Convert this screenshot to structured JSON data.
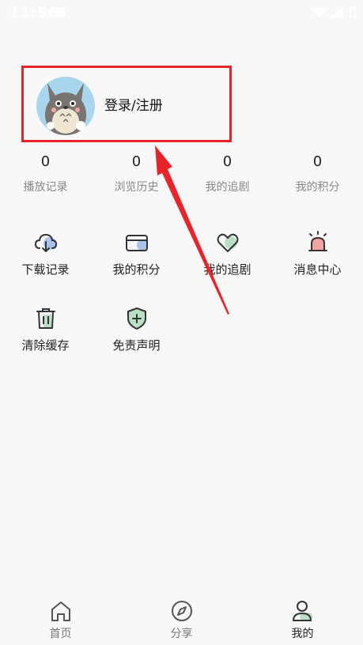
{
  "status": {
    "time": "11:56"
  },
  "profile": {
    "login_label": "登录/注册"
  },
  "stats": [
    {
      "value": "0",
      "label": "播放记录"
    },
    {
      "value": "0",
      "label": "浏览历史"
    },
    {
      "value": "0",
      "label": "我的追剧"
    },
    {
      "value": "0",
      "label": "我的积分"
    }
  ],
  "menu": [
    {
      "label": "下载记录",
      "icon": "cloud-download-icon"
    },
    {
      "label": "我的积分",
      "icon": "card-icon"
    },
    {
      "label": "我的追剧",
      "icon": "heart-icon"
    },
    {
      "label": "消息中心",
      "icon": "alarm-icon"
    },
    {
      "label": "清除缓存",
      "icon": "trash-icon"
    },
    {
      "label": "免责声明",
      "icon": "shield-icon"
    }
  ],
  "tabs": [
    {
      "label": "首页",
      "icon": "home-icon"
    },
    {
      "label": "分享",
      "icon": "compass-icon"
    },
    {
      "label": "我的",
      "icon": "user-icon",
      "active": true
    }
  ],
  "colors": {
    "highlight": "#e8242a",
    "accent_blue": "#a7c3f0",
    "accent_green": "#b9e0c4",
    "accent_red": "#f4a3a3"
  }
}
